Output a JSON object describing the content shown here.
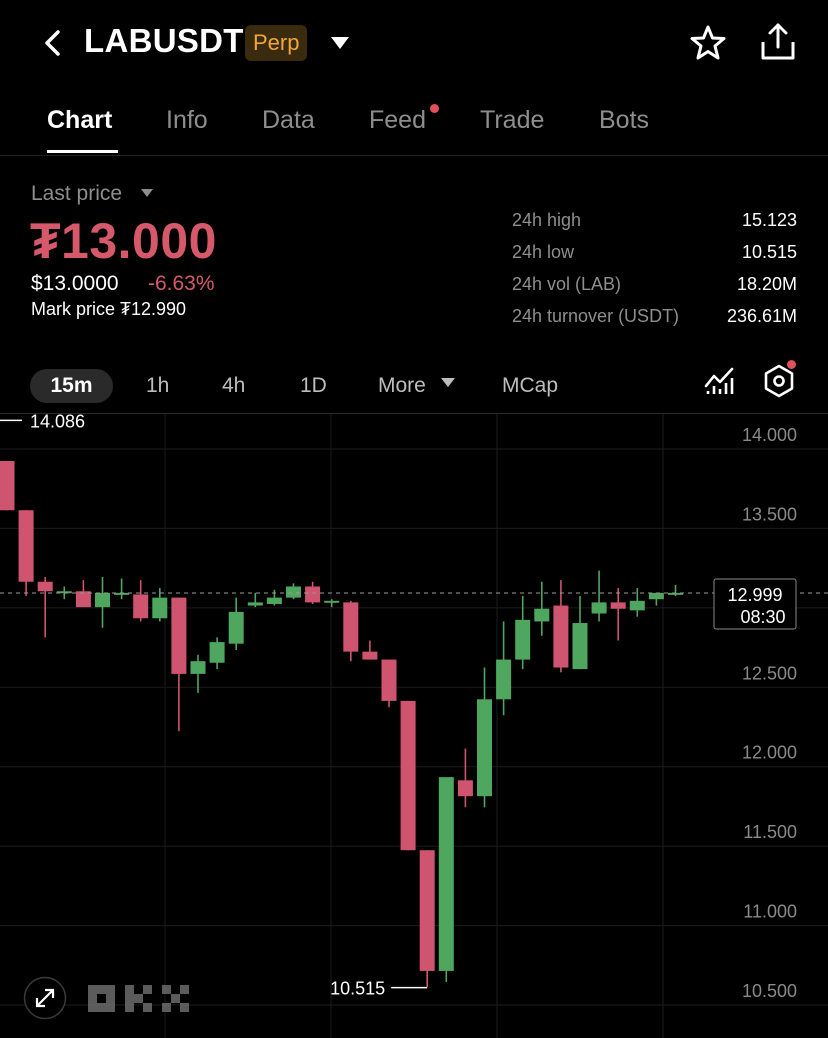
{
  "header": {
    "symbol": "LABUSDT",
    "badge": "Perp",
    "icons": [
      "back-icon",
      "caret-down-icon",
      "star-icon",
      "share-icon"
    ]
  },
  "tabs": [
    {
      "label": "Chart",
      "active": true
    },
    {
      "label": "Info",
      "active": false
    },
    {
      "label": "Data",
      "active": false
    },
    {
      "label": "Feed",
      "active": false,
      "notification_dot": true
    },
    {
      "label": "Trade",
      "active": false
    },
    {
      "label": "Bots",
      "active": false
    }
  ],
  "price": {
    "label": "Last price",
    "last": "₮13.000",
    "usd": "$13.0000",
    "change": "-6.63%",
    "mark": "Mark price ₮12.990"
  },
  "stats": [
    {
      "label": "24h high",
      "value": "15.123"
    },
    {
      "label": "24h low",
      "value": "10.515"
    },
    {
      "label": "24h vol (LAB)",
      "value": "18.20M"
    },
    {
      "label": "24h turnover (USDT)",
      "value": "236.61M"
    }
  ],
  "intervals": {
    "active": "15m",
    "options": [
      "1h",
      "4h",
      "1D"
    ],
    "more": "More",
    "mcap": "MCap"
  },
  "colors": {
    "up": "#4fa65f",
    "down": "#cf5470",
    "badge_bg": "#3a2a0e",
    "badge_text": "#f0a63a",
    "accent_dot": "#e2505a"
  },
  "chart_data": {
    "type": "candlestick",
    "y_ticks": [
      "14.000",
      "13.500",
      "13.000",
      "12.500",
      "12.000",
      "11.500",
      "11.000",
      "10.500"
    ],
    "ylim": [
      10.35,
      14.13
    ],
    "high_marker": "14.086",
    "low_marker": "10.515",
    "current_price": "12.999",
    "countdown": "08:30",
    "candles": [
      {
        "o": 13.83,
        "h": 13.83,
        "l": 13.52,
        "c": 13.52
      },
      {
        "o": 13.52,
        "h": 13.52,
        "l": 12.98,
        "c": 13.07
      },
      {
        "o": 13.07,
        "h": 13.1,
        "l": 12.72,
        "c": 13.01
      },
      {
        "o": 13.0,
        "h": 13.04,
        "l": 12.96,
        "c": 13.01
      },
      {
        "o": 13.01,
        "h": 13.08,
        "l": 12.93,
        "c": 12.91
      },
      {
        "o": 12.91,
        "h": 13.1,
        "l": 12.78,
        "c": 13.0
      },
      {
        "o": 12.99,
        "h": 13.09,
        "l": 12.96,
        "c": 13.0
      },
      {
        "o": 12.99,
        "h": 13.08,
        "l": 12.82,
        "c": 12.84
      },
      {
        "o": 12.84,
        "h": 13.03,
        "l": 12.82,
        "c": 12.97
      },
      {
        "o": 12.97,
        "h": 12.97,
        "l": 12.13,
        "c": 12.49
      },
      {
        "o": 12.49,
        "h": 12.61,
        "l": 12.37,
        "c": 12.57
      },
      {
        "o": 12.56,
        "h": 12.72,
        "l": 12.52,
        "c": 12.69
      },
      {
        "o": 12.68,
        "h": 12.97,
        "l": 12.64,
        "c": 12.88
      },
      {
        "o": 12.92,
        "h": 13.0,
        "l": 12.91,
        "c": 12.94
      },
      {
        "o": 12.93,
        "h": 13.02,
        "l": 12.92,
        "c": 12.97
      },
      {
        "o": 12.97,
        "h": 13.06,
        "l": 12.96,
        "c": 13.04
      },
      {
        "o": 13.04,
        "h": 13.07,
        "l": 12.93,
        "c": 12.94
      },
      {
        "o": 12.94,
        "h": 12.96,
        "l": 12.91,
        "c": 12.95
      },
      {
        "o": 12.94,
        "h": 12.95,
        "l": 12.57,
        "c": 12.63
      },
      {
        "o": 12.63,
        "h": 12.7,
        "l": 12.58,
        "c": 12.58
      },
      {
        "o": 12.58,
        "h": 12.58,
        "l": 12.28,
        "c": 12.32
      },
      {
        "o": 12.32,
        "h": 12.32,
        "l": 11.38,
        "c": 11.38
      },
      {
        "o": 11.38,
        "h": 11.38,
        "l": 10.52,
        "c": 10.62
      },
      {
        "o": 10.62,
        "h": 11.73,
        "l": 10.55,
        "c": 11.84
      },
      {
        "o": 11.82,
        "h": 12.02,
        "l": 11.65,
        "c": 11.72
      },
      {
        "o": 11.72,
        "h": 12.53,
        "l": 11.65,
        "c": 12.33
      },
      {
        "o": 12.33,
        "h": 12.82,
        "l": 12.23,
        "c": 12.58
      },
      {
        "o": 12.58,
        "h": 12.98,
        "l": 12.52,
        "c": 12.83
      },
      {
        "o": 12.82,
        "h": 13.07,
        "l": 12.73,
        "c": 12.9
      },
      {
        "o": 12.92,
        "h": 13.08,
        "l": 12.5,
        "c": 12.53
      },
      {
        "o": 12.52,
        "h": 12.98,
        "l": 12.52,
        "c": 12.81
      },
      {
        "o": 12.87,
        "h": 13.14,
        "l": 12.82,
        "c": 12.94
      },
      {
        "o": 12.94,
        "h": 13.03,
        "l": 12.7,
        "c": 12.9
      },
      {
        "o": 12.89,
        "h": 13.03,
        "l": 12.85,
        "c": 12.95
      },
      {
        "o": 12.96,
        "h": 13.0,
        "l": 12.92,
        "c": 13.0
      },
      {
        "o": 12.99,
        "h": 13.05,
        "l": 12.98,
        "c": 13.0
      }
    ]
  }
}
